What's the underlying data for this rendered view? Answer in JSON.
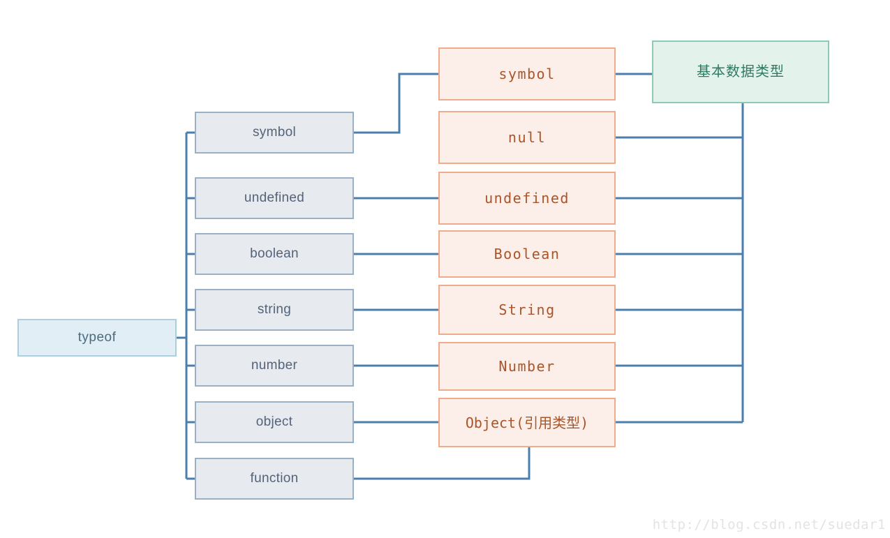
{
  "diagram": {
    "title": "JavaScript typeof and basic data types mind map",
    "colors": {
      "wire": "#4a7fad",
      "gray_fill": "#e7eaee",
      "gray_border": "#9bb0c4",
      "gray_text": "#53637a",
      "pink_fill": "#fceee8",
      "pink_border": "#efab8c",
      "pink_text": "#a9552a",
      "green_fill": "#e4f2ec",
      "green_border": "#8ccab4",
      "green_text": "#2f7a63",
      "root_fill": "#e2eef5",
      "root_border": "#a9cfe0",
      "root_text": "#4a6c80",
      "watermark_text": "#e3e3e1",
      "background": "#ffffff"
    },
    "root": {
      "label": "typeof"
    },
    "typeof_results": [
      {
        "label": "symbol"
      },
      {
        "label": "undefined"
      },
      {
        "label": "boolean"
      },
      {
        "label": "string"
      },
      {
        "label": "number"
      },
      {
        "label": "object"
      },
      {
        "label": "function"
      }
    ],
    "data_types": [
      {
        "label": "symbol"
      },
      {
        "label": "null"
      },
      {
        "label": "undefined"
      },
      {
        "label": "Boolean"
      },
      {
        "label": "String"
      },
      {
        "label": "Number"
      },
      {
        "label": "Object(引用类型)"
      }
    ],
    "category": {
      "label": "基本数据类型"
    },
    "watermark": {
      "text": "http://blog.csdn.net/suedar1"
    }
  }
}
